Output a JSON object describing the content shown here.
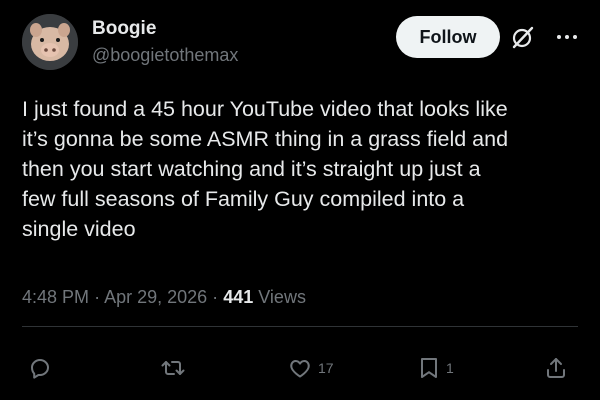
{
  "author": {
    "name": "Boogie",
    "handle": "@boogietothemax"
  },
  "header": {
    "follow_label": "Follow",
    "grok_icon": "grok-slash-circle-icon",
    "more_icon": "more-horizontal-icon"
  },
  "tweet": {
    "text": "I just found a 45 hour YouTube video that looks like\nit’s gonna be some ASMR thing in a grass field and\nthen you start watching and it’s straight up just a\nfew full seasons of Family Guy compiled into a\nsingle video"
  },
  "meta": {
    "time": "4:48 PM",
    "separator": "·",
    "date": "Apr 29, 2026",
    "views_count": "441",
    "views_label": "Views"
  },
  "actions": {
    "reply": {
      "icon": "reply-icon",
      "count": ""
    },
    "retweet": {
      "icon": "retweet-icon",
      "count": ""
    },
    "like": {
      "icon": "heart-icon",
      "count": "17"
    },
    "bookmark": {
      "icon": "bookmark-icon",
      "count": "1"
    },
    "share": {
      "icon": "share-icon"
    }
  },
  "colors": {
    "background": "#000000",
    "primary_text": "#e7e9ea",
    "secondary_text": "#71767b",
    "follow_bg": "#eff3f4",
    "follow_text": "#0f1419",
    "divider": "#2f3336"
  }
}
